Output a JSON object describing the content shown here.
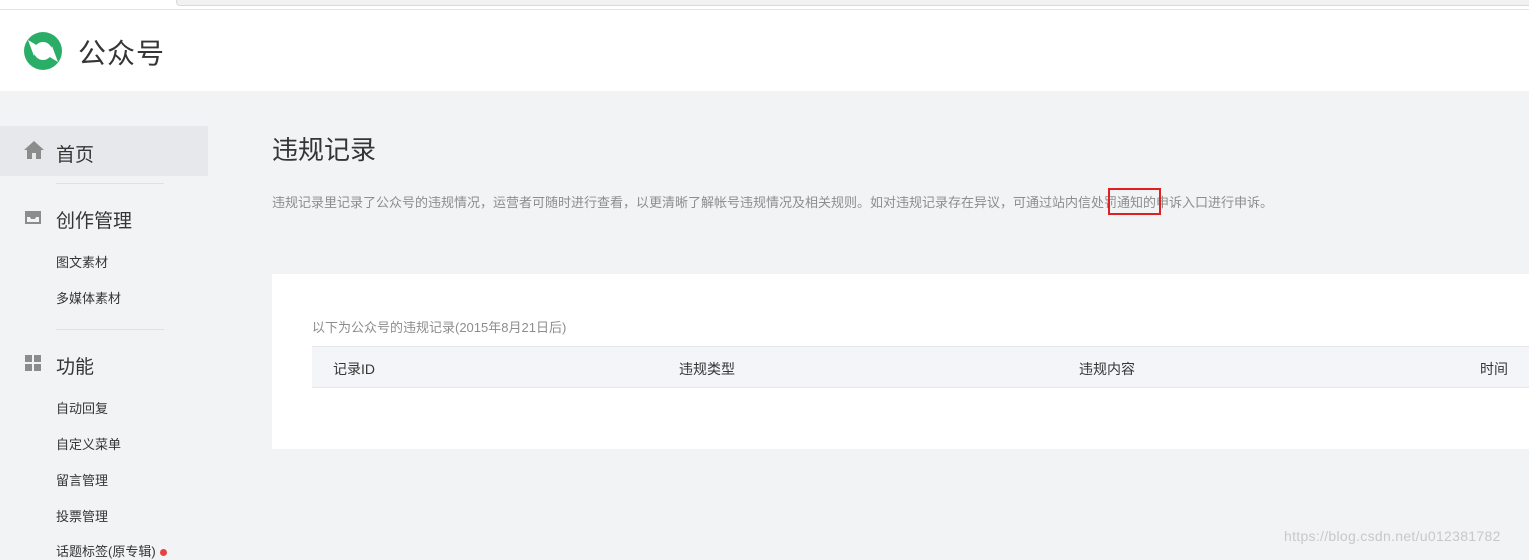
{
  "header": {
    "title": "公众号"
  },
  "sidebar": {
    "home": {
      "label": "首页"
    },
    "groups": [
      {
        "title": "创作管理",
        "items": [
          "图文素材",
          "多媒体素材"
        ]
      },
      {
        "title": "功能",
        "items": [
          "自动回复",
          "自定义菜单",
          "留言管理",
          "投票管理",
          "话题标签(原专辑)"
        ]
      }
    ]
  },
  "main": {
    "title": "违规记录",
    "description": "违规记录里记录了公众号的违规情况，运营者可随时进行查看，以更清晰了解帐号违规情况及相关规则。如对违规记录存在异议，可通过站内信处罚通知的申诉入口进行申诉。",
    "panel": {
      "caption": "以下为公众号的违规记录(2015年8月21日后)",
      "columns": [
        "记录ID",
        "违规类型",
        "违规内容",
        "时间"
      ]
    }
  },
  "watermark": "https://blog.csdn.net/u012381782",
  "colors": {
    "brand_green": "#2aae67",
    "highlight_red": "#e02020",
    "badge_red": "#e64340"
  }
}
